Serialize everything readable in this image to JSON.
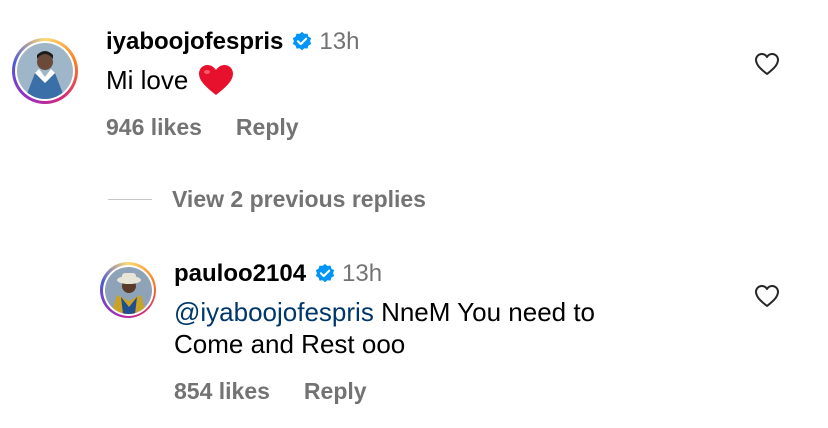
{
  "comments": [
    {
      "username": "iyaboojofespris",
      "time": "13h",
      "text": "Mi love",
      "emoji": "❤️",
      "likes": "946 likes",
      "reply": "Reply"
    },
    {
      "username": "pauloo2104",
      "time": "13h",
      "mention": "@iyaboojofespris",
      "text_line1": "NneM You need to",
      "text_line2": "Come and Rest ooo",
      "likes": "854 likes",
      "reply": "Reply"
    }
  ],
  "view_replies": "View 2 previous replies",
  "colors": {
    "verified": "#0095f6",
    "secondary_text": "#737373",
    "mention": "#00376b"
  },
  "icons": [
    "verified-badge-icon",
    "heart-outline-icon",
    "red-heart-emoji"
  ]
}
